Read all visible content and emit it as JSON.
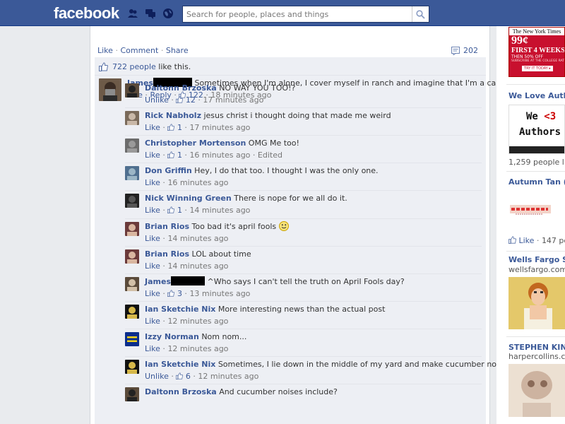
{
  "header": {
    "logo": "facebook",
    "search_placeholder": "Search for people, places and things",
    "icons": [
      "friend-requests-icon",
      "messages-icon",
      "notifications-icon",
      "search-icon"
    ]
  },
  "post_actions": {
    "like": "Like",
    "comment": "Comment",
    "share": "Share",
    "sep": "·",
    "comment_count": "202"
  },
  "likes_summary": {
    "count": "722 people",
    "suffix": " like this."
  },
  "top_comment": {
    "author": "James",
    "text": "Sometimes when I'm alone, I cover myself in ranch and imagine that I'm a carrot",
    "like": "Like",
    "reply": "Reply",
    "likes": "122",
    "time": "18 minutes ago"
  },
  "replies": [
    {
      "author": "Daltonn Brzoska",
      "text": "NO WAY YOU TOO!?",
      "action": "Unlike",
      "likes": "12",
      "time": "17 minutes ago",
      "edited": ""
    },
    {
      "author": "Rick Nabholz",
      "text": "jesus christ i thought doing that made me weird",
      "action": "Like",
      "likes": "1",
      "time": "17 minutes ago",
      "edited": ""
    },
    {
      "author": "Christopher Mortenson",
      "text": "OMG Me too!",
      "action": "Like",
      "likes": "1",
      "time": "16 minutes ago",
      "edited": "Edited"
    },
    {
      "author": "Don Griffin",
      "text": "Hey, I do that too. I thought I was the only one.",
      "action": "Like",
      "likes": "",
      "time": "16 minutes ago",
      "edited": ""
    },
    {
      "author": "Nick Winning Green",
      "text": "There is nope for we all do it.",
      "action": "Like",
      "likes": "1",
      "time": "14 minutes ago",
      "edited": ""
    },
    {
      "author": "Brian Rios",
      "text": "Too bad it's april fools",
      "action": "Like",
      "likes": "",
      "time": "14 minutes ago",
      "edited": ""
    },
    {
      "author": "Brian Rios",
      "text": "LOL about time",
      "action": "Like",
      "likes": "",
      "time": "14 minutes ago",
      "edited": ""
    },
    {
      "author": "James",
      "text": "^Who says I can't tell the truth on April Fools day?",
      "action": "Like",
      "likes": "3",
      "time": "13 minutes ago",
      "edited": ""
    },
    {
      "author": "Ian Sketchie Nix",
      "text": "More interesting news than the actual post",
      "action": "Like",
      "likes": "",
      "time": "12 minutes ago",
      "edited": ""
    },
    {
      "author": "Izzy Norman",
      "text": "Nom nom...",
      "action": "Like",
      "likes": "",
      "time": "12 minutes ago",
      "edited": ""
    },
    {
      "author": "Ian Sketchie Nix",
      "text": "Sometimes, I lie down in the middle of my yard and make cucumber noises",
      "action": "Unlike",
      "likes": "6",
      "time": "12 minutes ago",
      "edited": ""
    },
    {
      "author": "Daltonn Brzoska",
      "text": "And cucumber noises include?",
      "action": "",
      "likes": "",
      "time": "",
      "edited": ""
    }
  ],
  "right_rail": {
    "nyt": {
      "masthead": "The New York Times",
      "price": "99¢",
      "headline": "FIRST 4 WEEKS",
      "sub": "THEN 50% OFF",
      "fine": "SUBSCRIBE AT THE COLLEGE RATE",
      "cta": "TRY IT TODAY ▸"
    },
    "we_love_authors": {
      "title": "We Love Auth",
      "art_line1": "We ",
      "art_heart": "<3",
      "art_line2": "Authors",
      "likes": "1,259 people lik"
    },
    "autumn_tan": {
      "title": "Autumn Tan (",
      "like": "Like",
      "likes": "147 pe"
    },
    "wells_fargo": {
      "title": "Wells Fargo St",
      "sub": "wellsfargo.com"
    },
    "stephen_king": {
      "title": "STEPHEN KING",
      "sub": "harpercollins.com"
    }
  },
  "colors": {
    "brand": "#3b5998",
    "ufi_bg": "#edeff4",
    "link": "#3b5998"
  }
}
